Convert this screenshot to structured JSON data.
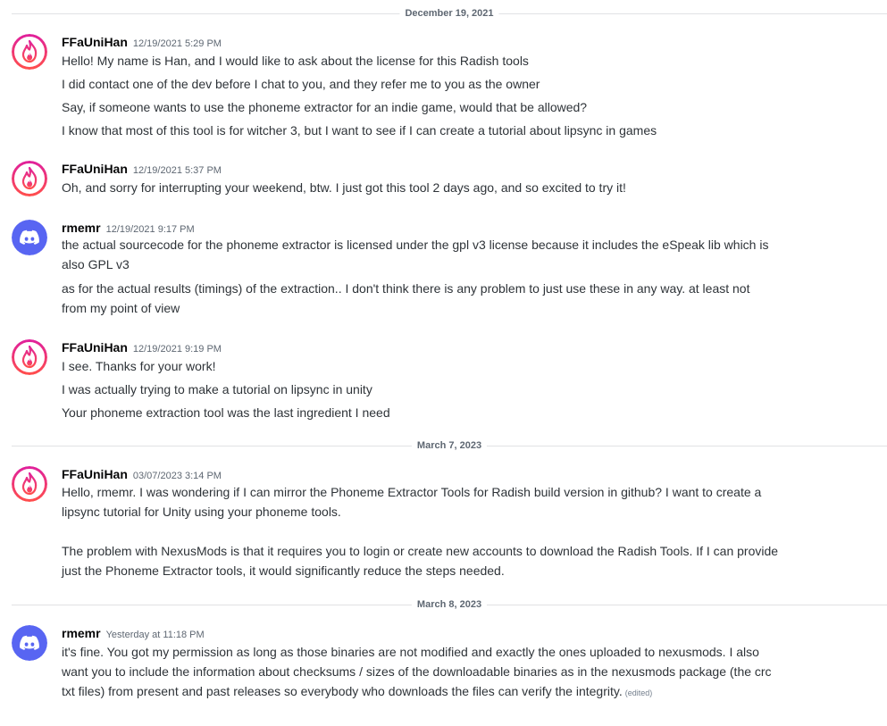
{
  "dividers": [
    {
      "label": "December 19, 2021"
    },
    {
      "label": "March 7, 2023"
    },
    {
      "label": "March 8, 2023"
    }
  ],
  "messages": [
    {
      "avatar_icon": "flame-icon",
      "username": "FFaUniHan",
      "timestamp": "12/19/2021 5:29 PM",
      "lines": [
        "Hello! My name is Han, and I would like to ask about the license for this Radish tools",
        "I did contact one of the dev before I chat to you, and they refer me to you as the owner",
        "Say, if someone wants to use the phoneme extractor for an indie game, would that be allowed?",
        "I know that most of this tool is for witcher 3, but I want to see if I can create a tutorial about lipsync in games"
      ]
    },
    {
      "avatar_icon": "flame-icon",
      "username": "FFaUniHan",
      "timestamp": "12/19/2021 5:37 PM",
      "lines": [
        "Oh, and sorry for interrupting your weekend, btw. I just got this tool 2 days ago, and so excited to try it!"
      ]
    },
    {
      "avatar_icon": "discord-logo-icon",
      "username": "rmemr",
      "timestamp": "12/19/2021 9:17 PM",
      "lines": [
        "the actual sourcecode for the phoneme extractor is licensed under the gpl v3 license because it includes the eSpeak lib which is",
        "also GPL v3",
        "as for the actual results (timings) of the extraction.. I don't think there is any problem to just use these in any way. at least not",
        "from my point of view"
      ]
    },
    {
      "avatar_icon": "flame-icon",
      "username": "FFaUniHan",
      "timestamp": "12/19/2021 9:19 PM",
      "lines": [
        "I see. Thanks for your work!",
        "I was actually trying to make a tutorial on lipsync in unity",
        "Your phoneme extraction tool was the last ingredient I need"
      ]
    },
    {
      "avatar_icon": "flame-icon",
      "username": "FFaUniHan",
      "timestamp": "03/07/2023 3:14 PM",
      "lines": [
        "Hello, rmemr. I was wondering if I can mirror the Phoneme Extractor Tools for Radish build version in github? I want to create a",
        "lipsync tutorial for Unity using your phoneme tools.",
        "The problem with NexusMods is that it requires you to login or create new accounts to download the Radish Tools. If I can provide",
        "just the Phoneme Extractor tools, it would significantly reduce the steps needed."
      ]
    },
    {
      "avatar_icon": "discord-logo-icon",
      "username": "rmemr",
      "timestamp": "Yesterday at 11:18 PM",
      "lines": [
        "it's fine. You got my permission as long as those binaries are not modified and exactly the ones uploaded to nexusmods. I also",
        "want you to include the information about checksums / sizes of the downloadable binaries as in the nexusmods package (the crc",
        "txt files) from present and past releases so everybody who downloads the files can verify the integrity."
      ],
      "edited_label": "(edited)"
    }
  ],
  "colors": {
    "flame_gradient_top": "#e0219a",
    "flame_gradient_bottom": "#ff4d4d",
    "discord_blurple": "#5865f2"
  }
}
